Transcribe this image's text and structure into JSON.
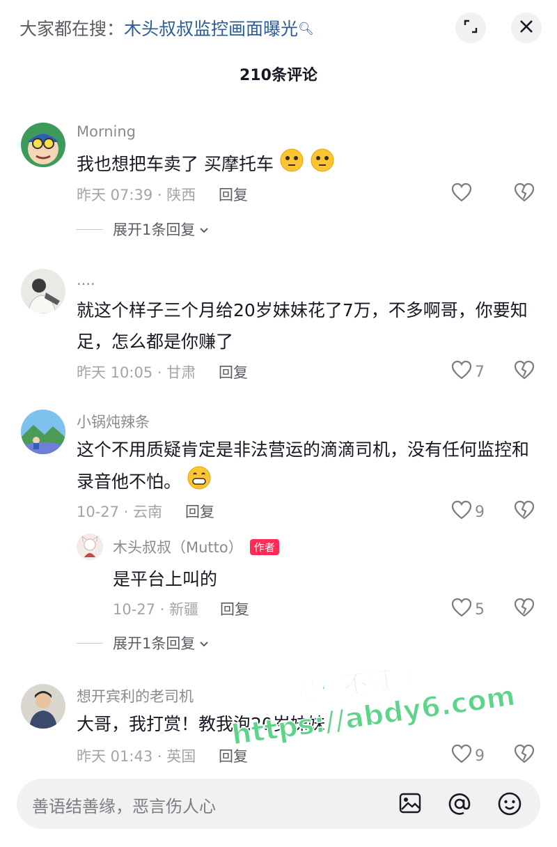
{
  "header": {
    "search_prefix": "大家都在搜：",
    "search_query": "木头叔叔监控画面曝光",
    "comment_count": "210条评论"
  },
  "icons": {
    "expand": "expand-screen-icon",
    "close": "close-icon",
    "like": "heart-outline-icon",
    "dislike": "broken-heart-icon",
    "image": "image-icon",
    "mention": "at-mention-icon",
    "emoji": "emoji-face-icon"
  },
  "colors": {
    "accent_link": "#2c5c94",
    "author_tag": "#fe2c55",
    "watermark": "#5fd38a"
  },
  "comments": [
    {
      "username": "Morning",
      "text": "我也想把车卖了 买摩托车",
      "time_location": "昨天 07:39 · 陕西",
      "reply_label": "回复",
      "likes": "",
      "expand_label": "展开1条回复"
    },
    {
      "username": "....",
      "text": "就这个样子三个月给20岁妹妹花了7万，不多啊哥，你要知足，怎么都是你赚了",
      "time_location": "昨天 10:05 · 甘肃",
      "reply_label": "回复",
      "likes": "7"
    },
    {
      "username": "小锅炖辣条",
      "text": "这个不用质疑肯定是非法营运的滴滴司机，没有任何监控和录音他不怕。",
      "time_location": "10-27 · 云南",
      "reply_label": "回复",
      "likes": "9",
      "reply": {
        "username": "木头叔叔（Mutto）",
        "author_tag": "作者",
        "text": "是平台上叫的",
        "time_location": "10-27 · 新疆",
        "reply_label": "回复",
        "likes": "5"
      },
      "expand_label": "展开1条回复"
    },
    {
      "username": "想开宾利的老司机",
      "text": "大哥，我打赏！教我泡20岁妹妹",
      "time_location": "昨天 01:43 · 英国",
      "reply_label": "回复",
      "likes": "9"
    }
  ],
  "input": {
    "placeholder": "善语结善缘，恶言伤人心"
  },
  "watermark": {
    "line1": "黑料不打烊",
    "line2": "https://abdy6.com"
  }
}
